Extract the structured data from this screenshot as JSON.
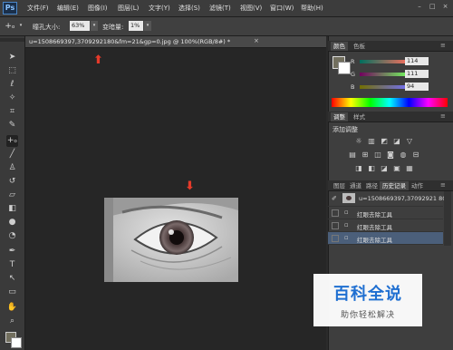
{
  "app": {
    "logo": "Ps"
  },
  "menu": [
    "文件(F)",
    "编辑(E)",
    "图像(I)",
    "图层(L)",
    "文字(Y)",
    "选择(S)",
    "滤镜(T)",
    "视图(V)",
    "窗口(W)",
    "帮助(H)"
  ],
  "window_controls": [
    "–",
    "□",
    "×"
  ],
  "options": {
    "pupil_size_label": "瞳孔大小:",
    "pupil_size_value": "63%",
    "darken_label": "变暗量:",
    "darken_value": "1%"
  },
  "document": {
    "tab_title": "u=1508669397,3709292180&fm=21&gp=0.jpg @ 100%(RGB/8#) *",
    "close": "×"
  },
  "color_panel": {
    "tabs": [
      "颜色",
      "色板"
    ],
    "channels": [
      {
        "label": "R",
        "value": "114"
      },
      {
        "label": "G",
        "value": "111"
      },
      {
        "label": "B",
        "value": "94"
      }
    ],
    "fg_color": "#726f5e",
    "bg_color": "#ffffff"
  },
  "adjust_panel": {
    "tabs": [
      "调整",
      "样式"
    ],
    "title": "添加调整"
  },
  "history_panel": {
    "tabs": [
      "图层",
      "通道",
      "路径",
      "历史记录",
      "动作"
    ],
    "snapshot": "u=1508669397,37092921 80...",
    "steps": [
      "红眼去除工具",
      "红眼去除工具",
      "红眼去除工具"
    ]
  },
  "watermark": {
    "title": "百科全说",
    "subtitle": "助你轻松解决"
  },
  "colors": {
    "accent_arrow": "#e53a2a",
    "history_active": "#4b5f7a",
    "watermark_blue": "#1f6fd1"
  }
}
